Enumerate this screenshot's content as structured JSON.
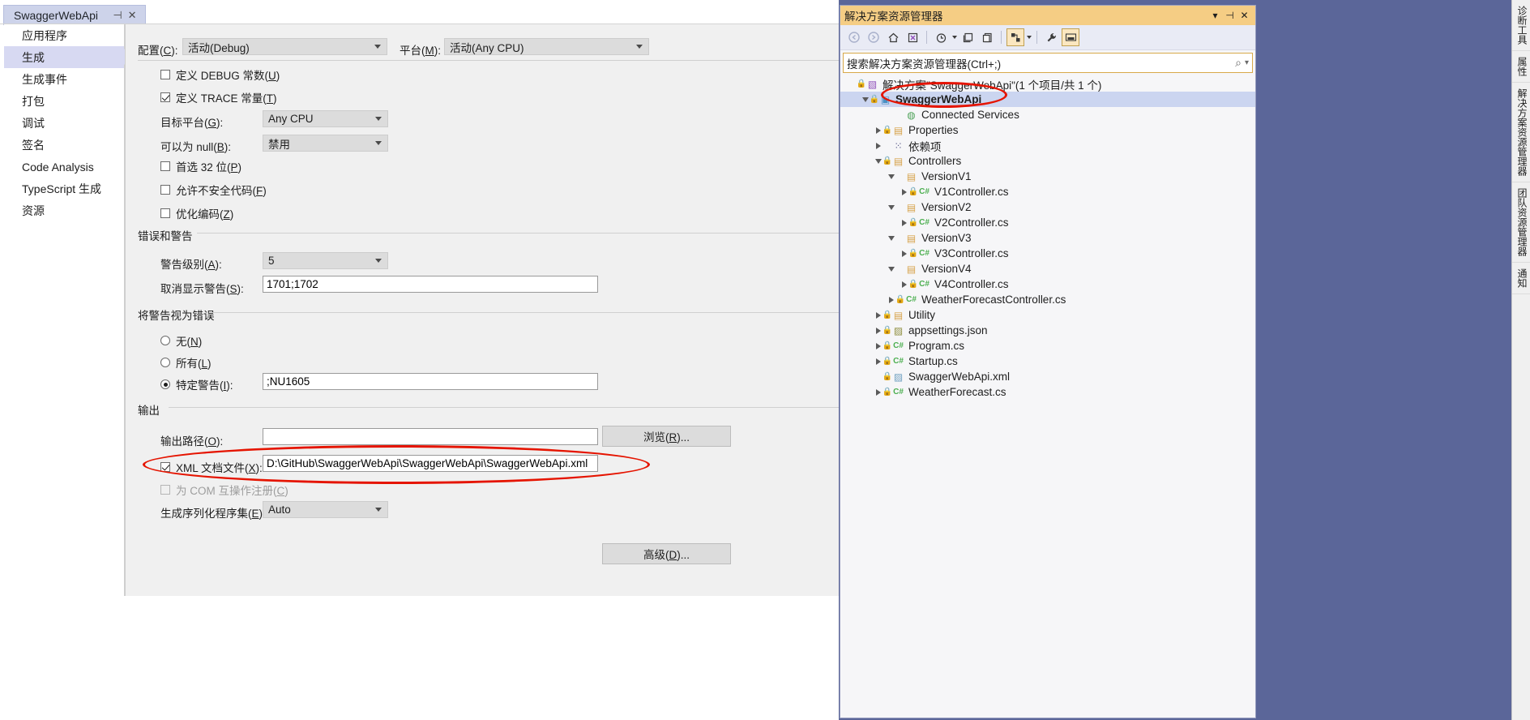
{
  "document_tab": {
    "title": "SwaggerWebApi",
    "pin_icon": "pin-icon",
    "close_icon": "close-icon",
    "pin_glyph": "⊣",
    "close_glyph": "✕"
  },
  "left_nav": {
    "items": [
      {
        "label": "应用程序",
        "selected": false
      },
      {
        "label": "生成",
        "selected": true
      },
      {
        "label": "生成事件",
        "selected": false
      },
      {
        "label": "打包",
        "selected": false
      },
      {
        "label": "调试",
        "selected": false
      },
      {
        "label": "签名",
        "selected": false
      },
      {
        "label": "Code Analysis",
        "selected": false
      },
      {
        "label": "TypeScript 生成",
        "selected": false
      },
      {
        "label": "资源",
        "selected": false
      }
    ]
  },
  "build_page": {
    "configuration": {
      "label_pre": "配置(",
      "label_key": "C",
      "label_post": "):",
      "value": "活动(Debug)"
    },
    "platform": {
      "label_pre": "平台(",
      "label_key": "M",
      "label_post": "):",
      "value": "活动(Any CPU)"
    },
    "general": {
      "define_debug": {
        "label_pre": "定义 DEBUG 常数(",
        "label_key": "U",
        "label_post": ")",
        "checked": false
      },
      "define_trace": {
        "label_pre": "定义 TRACE 常量(",
        "label_key": "T",
        "label_post": ")",
        "checked": true
      },
      "target_platform": {
        "label_pre": "目标平台(",
        "label_key": "G",
        "label_post": "):",
        "value": "Any CPU"
      },
      "nullable": {
        "label_pre": "可以为 null(",
        "label_key": "B",
        "label_post": "):",
        "value": "禁用"
      },
      "prefer32": {
        "label_pre": "首选 32 位(",
        "label_key": "P",
        "label_post": ")",
        "checked": false
      },
      "unsafe": {
        "label_pre": "允许不安全代码(",
        "label_key": "F",
        "label_post": ")",
        "checked": false
      },
      "optimize": {
        "label_pre": "优化编码(",
        "label_key": "Z",
        "label_post": ")",
        "checked": false
      }
    },
    "errors_warnings": {
      "group_title": "错误和警告",
      "warning_level": {
        "label_pre": "警告级别(",
        "label_key": "A",
        "label_post": "):",
        "value": "5"
      },
      "suppress_warnings": {
        "label_pre": "取消显示警告(",
        "label_key": "S",
        "label_post": "):",
        "value": "1701;1702"
      }
    },
    "treat_warnings": {
      "group_title": "将警告视为错误",
      "none": {
        "label_pre": "无(",
        "label_key": "N",
        "label_post": ")",
        "selected": false
      },
      "all": {
        "label_pre": "所有(",
        "label_key": "L",
        "label_post": ")",
        "selected": false
      },
      "specific": {
        "label_pre": "特定警告(",
        "label_key": "I",
        "label_post": "):",
        "selected": true,
        "value": ";NU1605"
      }
    },
    "output": {
      "group_title": "输出",
      "output_path": {
        "label_pre": "输出路径(",
        "label_key": "O",
        "label_post": "):",
        "value": ""
      },
      "browse_button": {
        "label_pre": "浏览(",
        "label_key": "R",
        "label_post": ")..."
      },
      "xml_doc": {
        "label_pre": "XML 文档文件(",
        "label_key": "X",
        "label_post": "):",
        "checked": true,
        "value": "D:\\GitHub\\SwaggerWebApi\\SwaggerWebApi\\SwaggerWebApi.xml"
      },
      "com_interop": {
        "label_pre": "为 COM 互操作注册(",
        "label_key": "C",
        "label_post": ")",
        "checked": false,
        "disabled": true
      },
      "serialization": {
        "label_pre": "生成序列化程序集(",
        "label_key": "E",
        "label_post": "):",
        "value": "Auto"
      },
      "advanced_button": {
        "label_pre": "高级(",
        "label_key": "D",
        "label_post": ")..."
      }
    }
  },
  "solution_explorer": {
    "title": "解决方案资源管理器",
    "window_controls": [
      {
        "name": "dropdown-icon",
        "glyph": "▾"
      },
      {
        "name": "pin-icon",
        "glyph": "⊣"
      },
      {
        "name": "close-icon",
        "glyph": "✕"
      }
    ],
    "toolbar": [
      {
        "name": "back-icon",
        "glyph": "◀"
      },
      {
        "name": "forward-icon",
        "glyph": "▶"
      },
      {
        "name": "home-icon",
        "glyph": "⌂"
      },
      {
        "name": "pending-changes-icon",
        "glyph": "▣"
      },
      {
        "name": "history-icon",
        "glyph": "◔"
      },
      {
        "name": "collapse-all-icon",
        "glyph": "▤"
      },
      {
        "name": "show-all-files-icon",
        "glyph": "▤"
      },
      {
        "name": "properties-icon",
        "glyph": "▨"
      },
      {
        "name": "wrench-icon",
        "glyph": "🔧"
      },
      {
        "name": "preview-icon",
        "glyph": "▬"
      }
    ],
    "search": {
      "placeholder": "搜索解决方案资源管理器(Ctrl+;)",
      "search_icon": "search-icon",
      "search_glyph": "⌕",
      "dropdown_glyph": "▾"
    },
    "tree": [
      {
        "label": "解决方案\"SwaggerWebApi\"(1 个项目/共 1 个)",
        "depth": 0,
        "expander": "none",
        "lock": true,
        "icon": "solution-icon",
        "glyph": "▧",
        "color": "#8f4fba",
        "selected": false,
        "bold": false
      },
      {
        "label": "SwaggerWebApi",
        "depth": 1,
        "expander": "open",
        "lock": true,
        "icon": "project-icon",
        "glyph": "▣",
        "color": "#4a90c4",
        "selected": true,
        "bold": true
      },
      {
        "label": "Connected Services",
        "depth": 3,
        "expander": "none",
        "lock": false,
        "icon": "connected-services-icon",
        "glyph": "◍",
        "color": "#4fa35a",
        "selected": false,
        "bold": false
      },
      {
        "label": "Properties",
        "depth": 2,
        "expander": "closed",
        "lock": true,
        "icon": "properties-folder-icon",
        "glyph": "▤",
        "color": "#d6a24a",
        "selected": false,
        "bold": false
      },
      {
        "label": "依赖项",
        "depth": 2,
        "expander": "closed",
        "lock": false,
        "icon": "dependencies-icon",
        "glyph": "⁙",
        "color": "#5a5a8a",
        "selected": false,
        "bold": false
      },
      {
        "label": "Controllers",
        "depth": 2,
        "expander": "open",
        "lock": true,
        "icon": "folder-icon",
        "glyph": "▤",
        "color": "#d6a24a",
        "selected": false,
        "bold": false
      },
      {
        "label": "VersionV1",
        "depth": 3,
        "expander": "open",
        "lock": false,
        "icon": "folder-icon",
        "glyph": "▤",
        "color": "#d6a24a",
        "selected": false,
        "bold": false
      },
      {
        "label": "V1Controller.cs",
        "depth": 4,
        "expander": "closed",
        "lock": true,
        "icon": "csharp-icon",
        "glyph": "C#",
        "color": "#4caf50",
        "selected": false,
        "bold": false
      },
      {
        "label": "VersionV2",
        "depth": 3,
        "expander": "open",
        "lock": false,
        "icon": "folder-icon",
        "glyph": "▤",
        "color": "#d6a24a",
        "selected": false,
        "bold": false
      },
      {
        "label": "V2Controller.cs",
        "depth": 4,
        "expander": "closed",
        "lock": true,
        "icon": "csharp-icon",
        "glyph": "C#",
        "color": "#4caf50",
        "selected": false,
        "bold": false
      },
      {
        "label": "VersionV3",
        "depth": 3,
        "expander": "open",
        "lock": false,
        "icon": "folder-icon",
        "glyph": "▤",
        "color": "#d6a24a",
        "selected": false,
        "bold": false
      },
      {
        "label": "V3Controller.cs",
        "depth": 4,
        "expander": "closed",
        "lock": true,
        "icon": "csharp-icon",
        "glyph": "C#",
        "color": "#4caf50",
        "selected": false,
        "bold": false
      },
      {
        "label": "VersionV4",
        "depth": 3,
        "expander": "open",
        "lock": false,
        "icon": "folder-icon",
        "glyph": "▤",
        "color": "#d6a24a",
        "selected": false,
        "bold": false
      },
      {
        "label": "V4Controller.cs",
        "depth": 4,
        "expander": "closed",
        "lock": true,
        "icon": "csharp-icon",
        "glyph": "C#",
        "color": "#4caf50",
        "selected": false,
        "bold": false
      },
      {
        "label": "WeatherForecastController.cs",
        "depth": 3,
        "expander": "closed",
        "lock": true,
        "icon": "csharp-icon",
        "glyph": "C#",
        "color": "#4caf50",
        "selected": false,
        "bold": false
      },
      {
        "label": "Utility",
        "depth": 2,
        "expander": "closed",
        "lock": true,
        "icon": "folder-icon",
        "glyph": "▤",
        "color": "#d6a24a",
        "selected": false,
        "bold": false
      },
      {
        "label": "appsettings.json",
        "depth": 2,
        "expander": "closed",
        "lock": true,
        "icon": "json-icon",
        "glyph": "▨",
        "color": "#8f8f3f",
        "selected": false,
        "bold": false
      },
      {
        "label": "Program.cs",
        "depth": 2,
        "expander": "closed",
        "lock": true,
        "icon": "csharp-icon",
        "glyph": "C#",
        "color": "#4caf50",
        "selected": false,
        "bold": false
      },
      {
        "label": "Startup.cs",
        "depth": 2,
        "expander": "closed",
        "lock": true,
        "icon": "csharp-icon",
        "glyph": "C#",
        "color": "#4caf50",
        "selected": false,
        "bold": false
      },
      {
        "label": "SwaggerWebApi.xml",
        "depth": 2,
        "expander": "none",
        "lock": true,
        "icon": "xml-icon",
        "glyph": "▨",
        "color": "#6fa0c0",
        "selected": false,
        "bold": false
      },
      {
        "label": "WeatherForecast.cs",
        "depth": 2,
        "expander": "closed",
        "lock": true,
        "icon": "csharp-icon",
        "glyph": "C#",
        "color": "#4caf50",
        "selected": false,
        "bold": false
      }
    ]
  },
  "vertical_tabs": [
    {
      "label": "诊断工具"
    },
    {
      "label": "属性"
    },
    {
      "label": "解决方案资源管理器"
    },
    {
      "label": "团队资源管理器"
    },
    {
      "label": "通知"
    }
  ],
  "annotations": {
    "accent_color": "#e51400"
  }
}
